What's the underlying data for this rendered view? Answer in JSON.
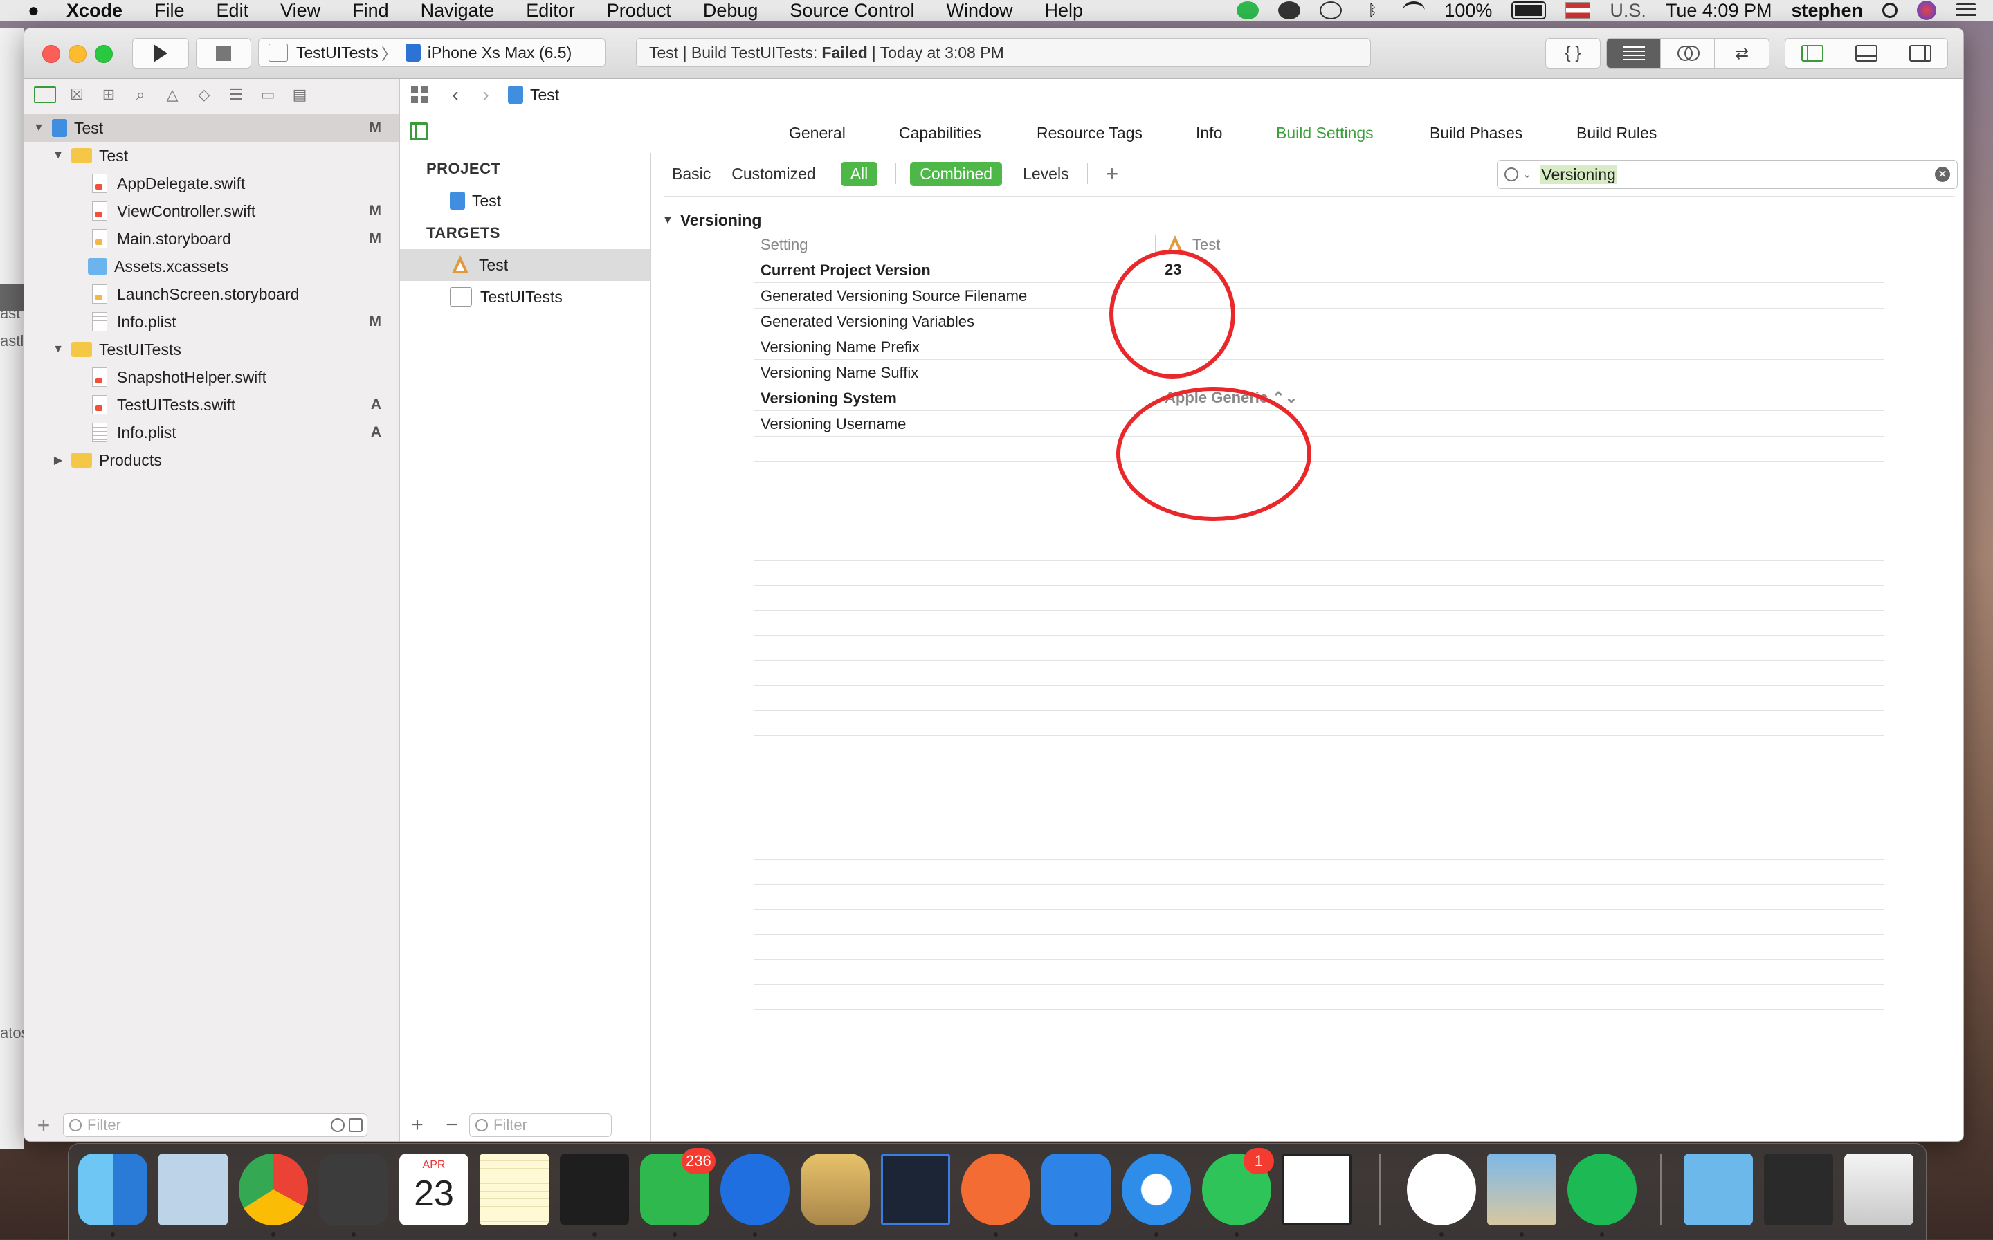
{
  "menubar": {
    "app": "Xcode",
    "menus": [
      "File",
      "Edit",
      "View",
      "Find",
      "Navigate",
      "Editor",
      "Product",
      "Debug",
      "Source Control",
      "Window",
      "Help"
    ],
    "battery": "100%",
    "input_source": "U.S.",
    "clock": "Tue 4:09 PM",
    "user": "stephen"
  },
  "desktop": {
    "edge_text_1": "ast",
    "edge_text_2": "astl",
    "edge_text_3": "atos"
  },
  "toolbar": {
    "scheme": "TestUITests",
    "destination": "iPhone Xs Max (6.5)",
    "activity_prefix": "Test | Build TestUITests:",
    "activity_status": "Failed",
    "activity_suffix": "| Today at 3:08 PM"
  },
  "navigator": {
    "items": [
      {
        "label": "Test",
        "badge": "M"
      },
      {
        "label": "Test",
        "badge": ""
      },
      {
        "label": "AppDelegate.swift",
        "badge": ""
      },
      {
        "label": "ViewController.swift",
        "badge": "M"
      },
      {
        "label": "Main.storyboard",
        "badge": "M"
      },
      {
        "label": "Assets.xcassets",
        "badge": ""
      },
      {
        "label": "LaunchScreen.storyboard",
        "badge": ""
      },
      {
        "label": "Info.plist",
        "badge": "M"
      },
      {
        "label": "TestUITests",
        "badge": ""
      },
      {
        "label": "SnapshotHelper.swift",
        "badge": ""
      },
      {
        "label": "TestUITests.swift",
        "badge": "A"
      },
      {
        "label": "Info.plist",
        "badge": "A"
      },
      {
        "label": "Products",
        "badge": ""
      }
    ],
    "filter_placeholder": "Filter"
  },
  "jumpbar": {
    "crumb": "Test"
  },
  "editor_tabs": [
    "General",
    "Capabilities",
    "Resource Tags",
    "Info",
    "Build Settings",
    "Build Phases",
    "Build Rules"
  ],
  "targets_panel": {
    "project_header": "PROJECT",
    "project_item": "Test",
    "targets_header": "TARGETS",
    "targets": [
      "Test",
      "TestUITests"
    ],
    "filter_placeholder": "Filter"
  },
  "build_settings": {
    "filters": {
      "basic": "Basic",
      "customized": "Customized",
      "all": "All",
      "combined": "Combined",
      "levels": "Levels"
    },
    "search_value": "Versioning",
    "section": "Versioning",
    "header_setting": "Setting",
    "header_target": "Test",
    "rows": [
      {
        "name": "Current Project Version",
        "value": "23"
      },
      {
        "name": "Generated Versioning Source Filename",
        "value": ""
      },
      {
        "name": "Generated Versioning Variables",
        "value": ""
      },
      {
        "name": "Versioning Name Prefix",
        "value": ""
      },
      {
        "name": "Versioning Name Suffix",
        "value": ""
      },
      {
        "name": "Versioning System",
        "value": "Apple Generic ⌃⌄"
      },
      {
        "name": "Versioning Username",
        "value": ""
      }
    ]
  },
  "dock": {
    "calendar_month": "APR",
    "calendar_day": "23",
    "line_badge": "236",
    "whatsapp_badge": "1"
  },
  "colors": {
    "accent_green": "#4db748",
    "annotation_red": "#e8282a",
    "selection_gray": "#dcdcdc"
  }
}
